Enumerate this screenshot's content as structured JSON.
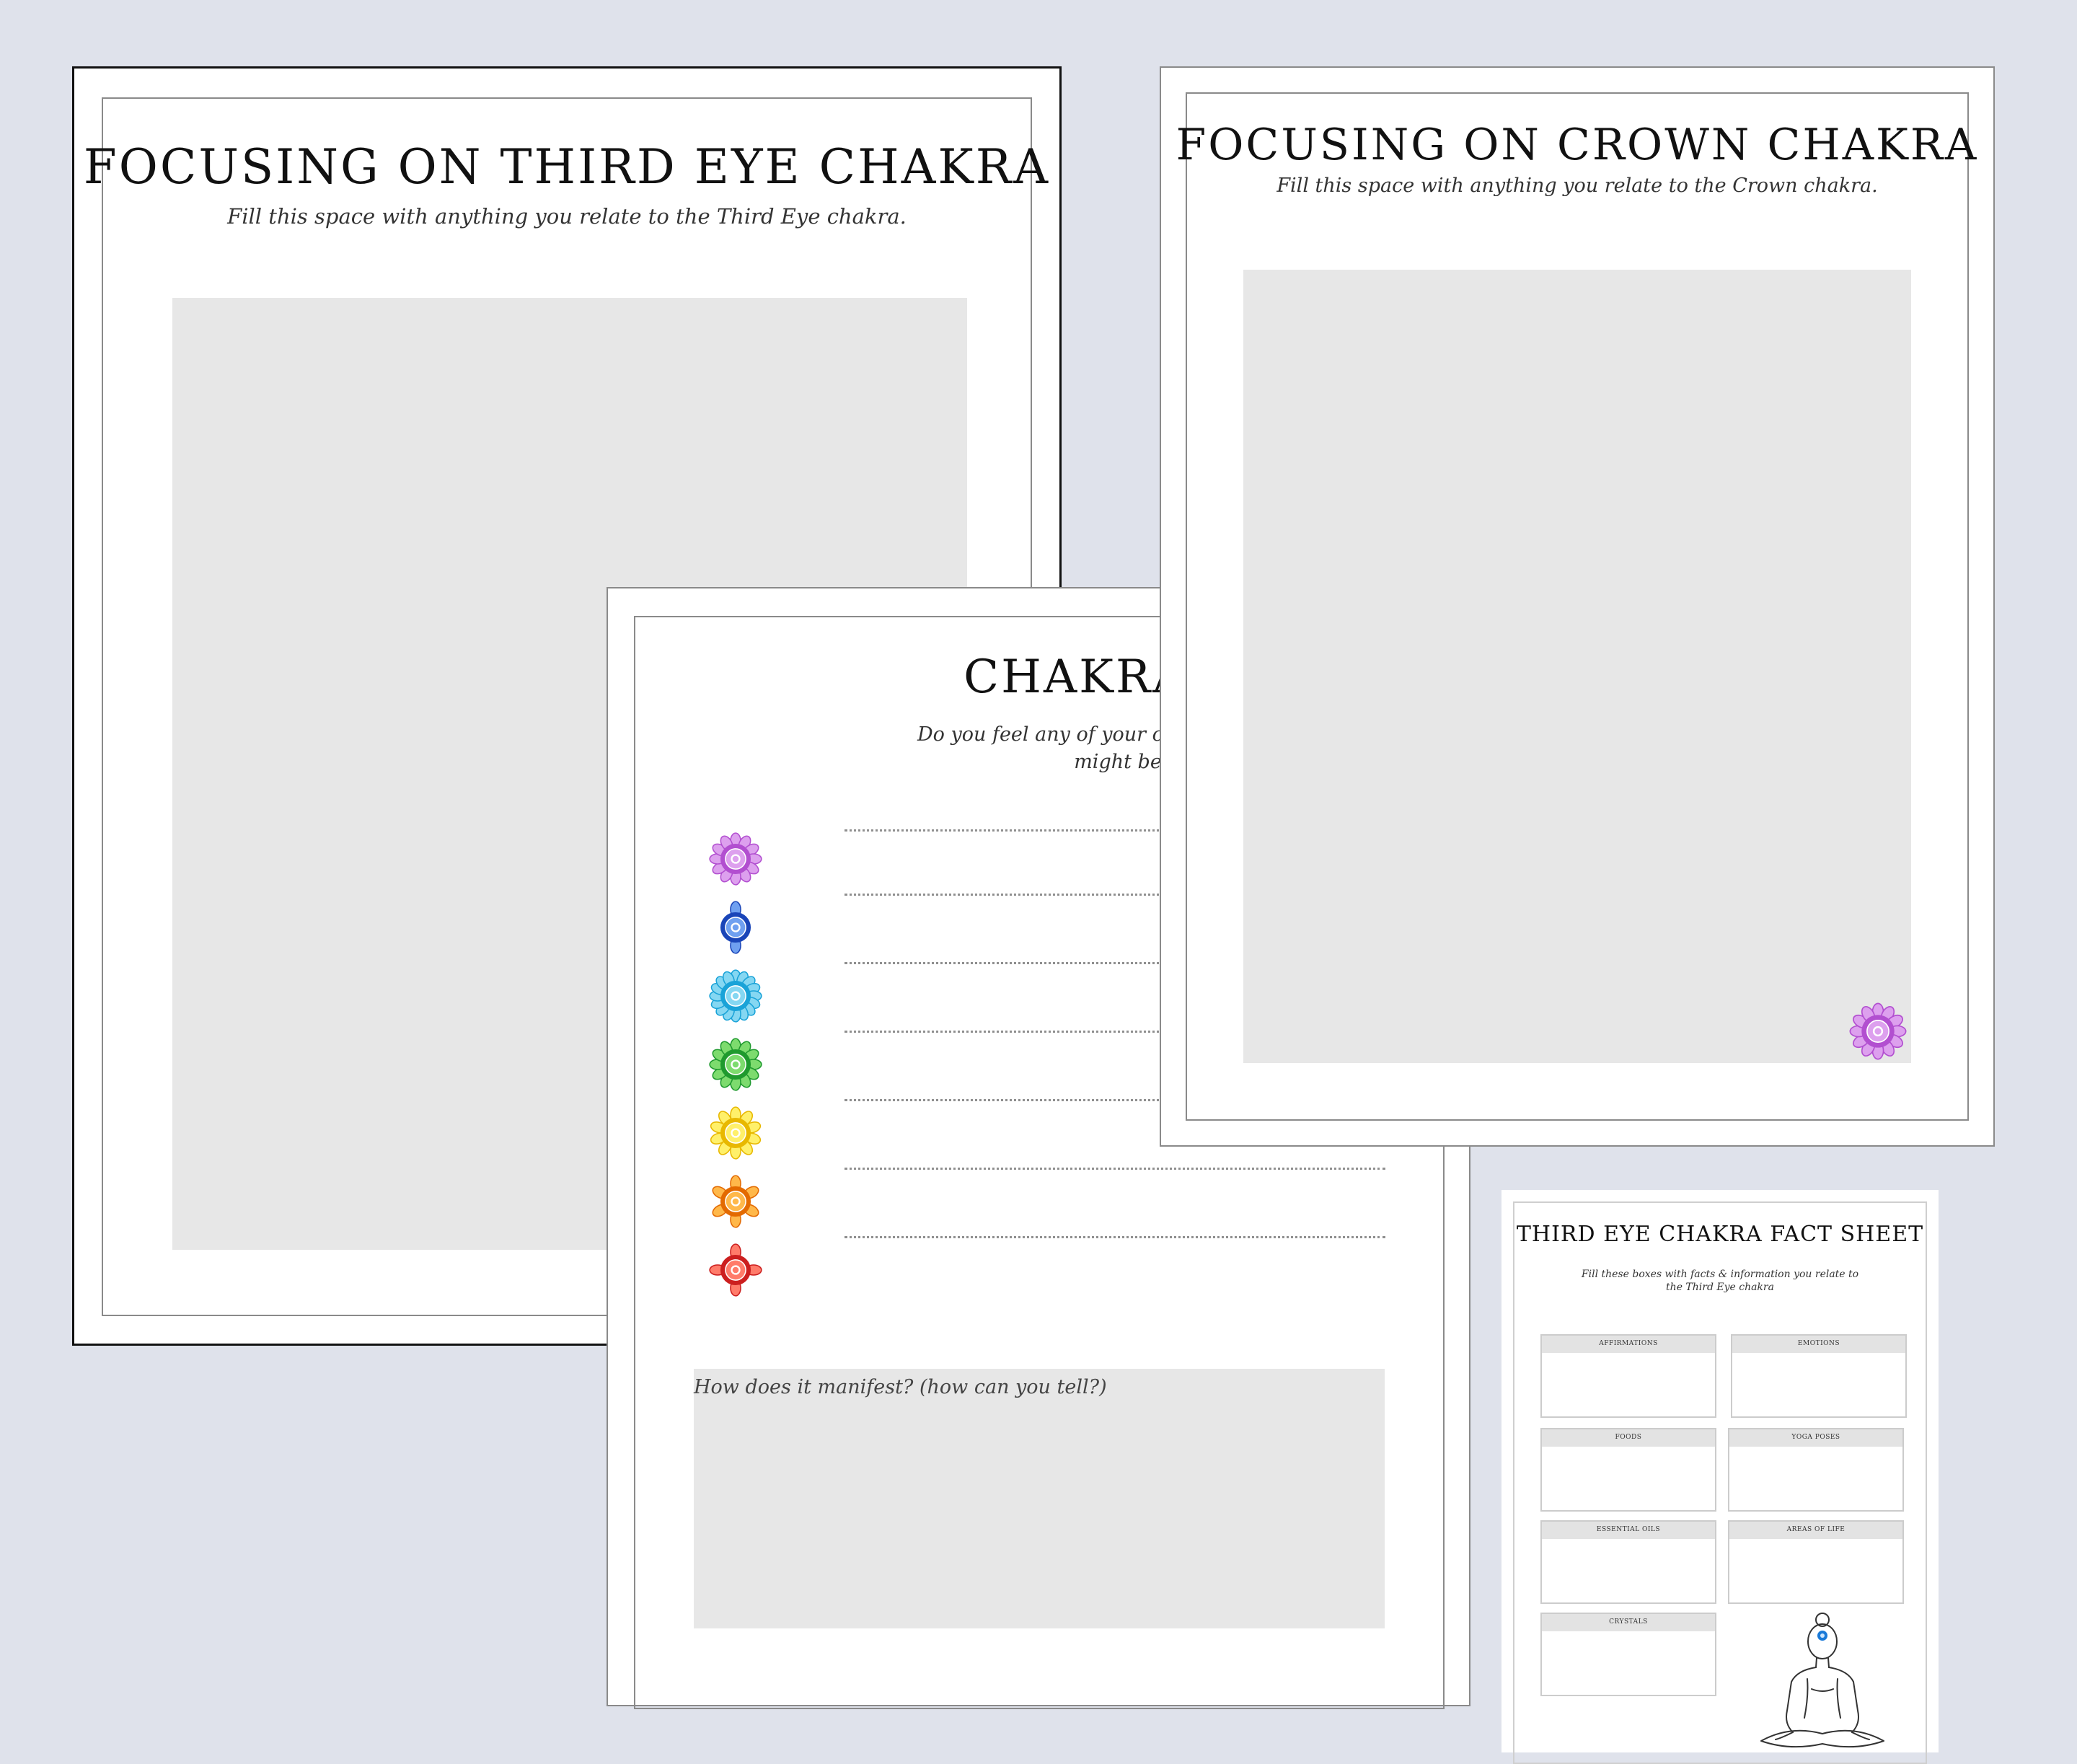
{
  "pages": {
    "third_eye": {
      "title": "FOCUSING ON THIRD EYE CHAKRA",
      "subtitle": "Fill this space with anything you relate to the Third Eye chakra."
    },
    "worksheet": {
      "title": "CHAKRA WORKS",
      "subtitle_line1": "Do you feel any of your chakras are blocked? Why",
      "subtitle_line2": "might be blocked?",
      "chakras": [
        {
          "name": "crown-chakra-icon",
          "color": "#b24fd0",
          "light": "#dda0ee"
        },
        {
          "name": "third-eye-chakra-icon",
          "color": "#1a45b8",
          "light": "#6fa0f0"
        },
        {
          "name": "throat-chakra-icon",
          "color": "#1aa3d8",
          "light": "#85d7f2"
        },
        {
          "name": "heart-chakra-icon",
          "color": "#1f9a2e",
          "light": "#7ddb6e"
        },
        {
          "name": "solar-plexus-chakra-icon",
          "color": "#e8b800",
          "light": "#fff06a"
        },
        {
          "name": "sacral-chakra-icon",
          "color": "#e36a00",
          "light": "#ffb84a"
        },
        {
          "name": "root-chakra-icon",
          "color": "#cc1f1f",
          "light": "#ff7b6a"
        }
      ],
      "manifest_label": "How does it manifest? (how can you tell?)"
    },
    "crown": {
      "title": "FOCUSING ON CROWN CHAKRA",
      "subtitle": "Fill this space with anything you relate to the Crown chakra."
    },
    "fact_sheet": {
      "title": "THIRD EYE CHAKRA FACT SHEET",
      "subtitle_line1": "Fill these boxes with facts & information you relate to",
      "subtitle_line2": "the Third Eye chakra",
      "boxes": [
        "AFFIRMATIONS",
        "EMOTIONS",
        "FOODS",
        "YOGA POSES",
        "ESSENTIAL OILS",
        "AREAS OF LIFE",
        "CRYSTALS"
      ]
    }
  },
  "colors": {
    "background": "#dfe2eb",
    "fill_area": "#e7e7e7",
    "crown_purple": "#b24fd0"
  }
}
